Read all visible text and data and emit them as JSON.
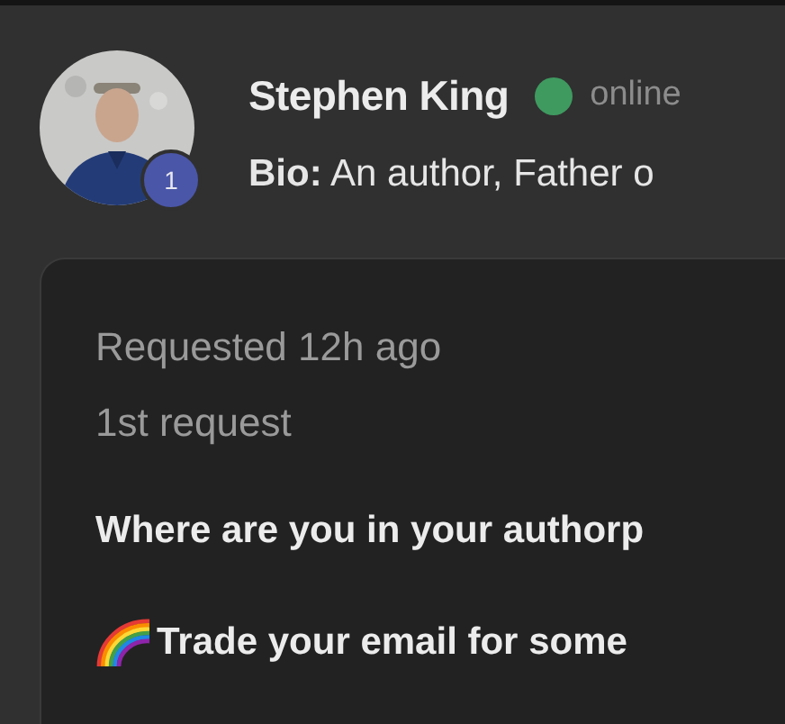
{
  "profile": {
    "name": "Stephen King",
    "status": {
      "online": true,
      "label": "online"
    },
    "badge": "1",
    "bio": "**Bio:** An author, Father o"
  },
  "request": {
    "time": "Requested 12h ago",
    "count": "1st request",
    "lines": [
      {
        "kind": "text",
        "text": "Where are you in your authorp"
      },
      {
        "kind": "rainbow",
        "text": "Trade your email for some"
      }
    ]
  }
}
